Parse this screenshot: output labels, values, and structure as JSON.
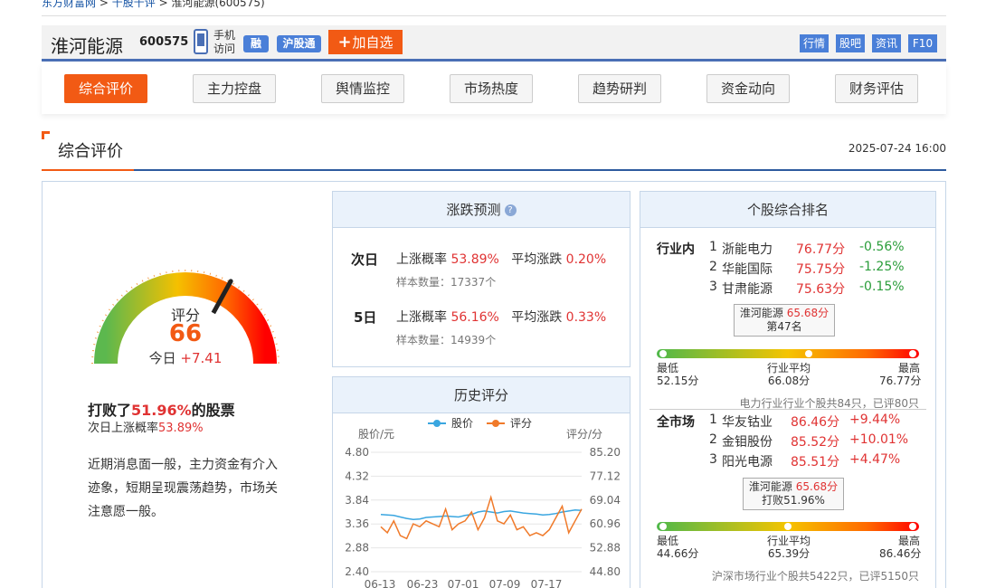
{
  "breadcrumb": {
    "site": "东方财富网",
    "sep1": ">",
    "section": "千股千评",
    "sep2": ">",
    "current": "淮河能源(600575)"
  },
  "stock": {
    "name": "淮河能源",
    "code": "600575",
    "mobile_label": "手机访问",
    "badge_margin": "融",
    "badge_connect": "沪股通",
    "add_label": "加自选",
    "links": [
      "行情",
      "股吧",
      "资讯",
      "F10"
    ]
  },
  "tabs": [
    "综合评价",
    "主力控盘",
    "舆情监控",
    "市场热度",
    "趋势研判",
    "资金动向",
    "财务评估"
  ],
  "section": {
    "title": "综合评价",
    "datetime": "2025-07-24 16:00"
  },
  "gauge": {
    "label": "评分",
    "score": "66",
    "score_value": 66,
    "today_label": "今日",
    "today_change": "+7.41"
  },
  "summary": {
    "beat_prefix": "打败了",
    "beat_pct": "51.96%",
    "beat_suffix": "的股票",
    "next_prefix": "次日上涨概率",
    "next_pct": "53.89%",
    "description": "近期消息面一般，主力资金有介入迹象，短期呈现震荡趋势，市场关注意愿一般。"
  },
  "prediction": {
    "title": "涨跌预测",
    "rows": [
      {
        "period": "次日",
        "up_label": "上涨概率",
        "up_value": "53.89%",
        "avg_label": "平均涨跌",
        "avg_value": "0.20%",
        "sample_label": "样本数量：",
        "sample_value": "17337个"
      },
      {
        "period": "5日",
        "up_label": "上涨概率",
        "up_value": "56.16%",
        "avg_label": "平均涨跌",
        "avg_value": "0.33%",
        "sample_label": "样本数量：",
        "sample_value": "14939个"
      }
    ]
  },
  "history": {
    "title": "历史评分",
    "left_axis_label": "股价/元",
    "right_axis_label": "评分/分",
    "legend": [
      "股价",
      "评分"
    ],
    "colors": {
      "price": "#3aa6e0",
      "score": "#f07a2a"
    }
  },
  "chart_data": {
    "type": "line",
    "x_ticks": [
      "06-13",
      "06-23",
      "07-01",
      "07-09",
      "07-17"
    ],
    "y_left_ticks": [
      "4.80",
      "4.32",
      "3.84",
      "3.36",
      "2.88",
      "2.40"
    ],
    "y_right_ticks": [
      "85.20",
      "77.12",
      "69.04",
      "60.96",
      "52.88",
      "44.80"
    ],
    "ylim_left": [
      2.4,
      4.8
    ],
    "ylim_right": [
      44.8,
      85.2
    ],
    "series": [
      {
        "name": "股价",
        "axis": "left",
        "color": "#3aa6e0",
        "values": [
          3.55,
          3.54,
          3.53,
          3.5,
          3.47,
          3.45,
          3.46,
          3.49,
          3.5,
          3.51,
          3.52,
          3.51,
          3.5,
          3.53,
          3.55,
          3.6,
          3.62,
          3.6,
          3.58,
          3.61,
          3.62,
          3.6,
          3.58,
          3.57,
          3.56,
          3.54,
          3.55,
          3.57,
          3.6,
          3.62,
          3.64,
          3.63
        ]
      },
      {
        "name": "评分",
        "axis": "right",
        "color": "#f07a2a",
        "values": [
          60,
          58,
          62,
          57,
          56,
          61,
          60,
          62,
          61,
          60,
          66,
          59,
          61,
          62,
          65,
          59,
          63,
          70,
          62,
          61,
          64,
          59,
          60,
          57,
          58,
          57,
          59,
          63,
          67,
          58,
          62,
          66
        ]
      }
    ]
  },
  "ranking": {
    "title": "个股综合排名",
    "industry": {
      "label": "行业内",
      "rows": [
        {
          "rank": "1",
          "name": "浙能电力",
          "score": "76.77分",
          "change": "-0.56%",
          "dir": "down"
        },
        {
          "rank": "2",
          "name": "华能国际",
          "score": "75.75分",
          "change": "-1.25%",
          "dir": "down"
        },
        {
          "rank": "3",
          "name": "甘肃能源",
          "score": "75.63分",
          "change": "-0.15%",
          "dir": "down"
        }
      ],
      "tip_name": "淮河能源",
      "tip_score": "65.68分",
      "tip_line2": "第47名",
      "marker_pos": 0.58,
      "min_label": "最低",
      "min_value": "52.15分",
      "avg_label": "行业平均",
      "avg_value": "66.08分",
      "max_label": "最高",
      "max_value": "76.77分",
      "footer": "电力行业行业个股共84只，已评80只"
    },
    "market": {
      "label": "全市场",
      "rows": [
        {
          "rank": "1",
          "name": "华友钴业",
          "score": "86.46分",
          "change": "+9.44%",
          "dir": "up"
        },
        {
          "rank": "2",
          "name": "金钼股份",
          "score": "85.52分",
          "change": "+10.01%",
          "dir": "up"
        },
        {
          "rank": "3",
          "name": "阳光电源",
          "score": "85.51分",
          "change": "+4.47%",
          "dir": "up"
        }
      ],
      "tip_name": "淮河能源",
      "tip_score": "65.68分",
      "tip_line2": "打败51.96%",
      "marker_pos": 0.5,
      "min_label": "最低",
      "min_value": "44.66分",
      "avg_label": "行业平均",
      "avg_value": "65.39分",
      "max_label": "最高",
      "max_value": "86.46分",
      "footer": "沪深市场行业个股共5422只，已评5150只"
    }
  }
}
